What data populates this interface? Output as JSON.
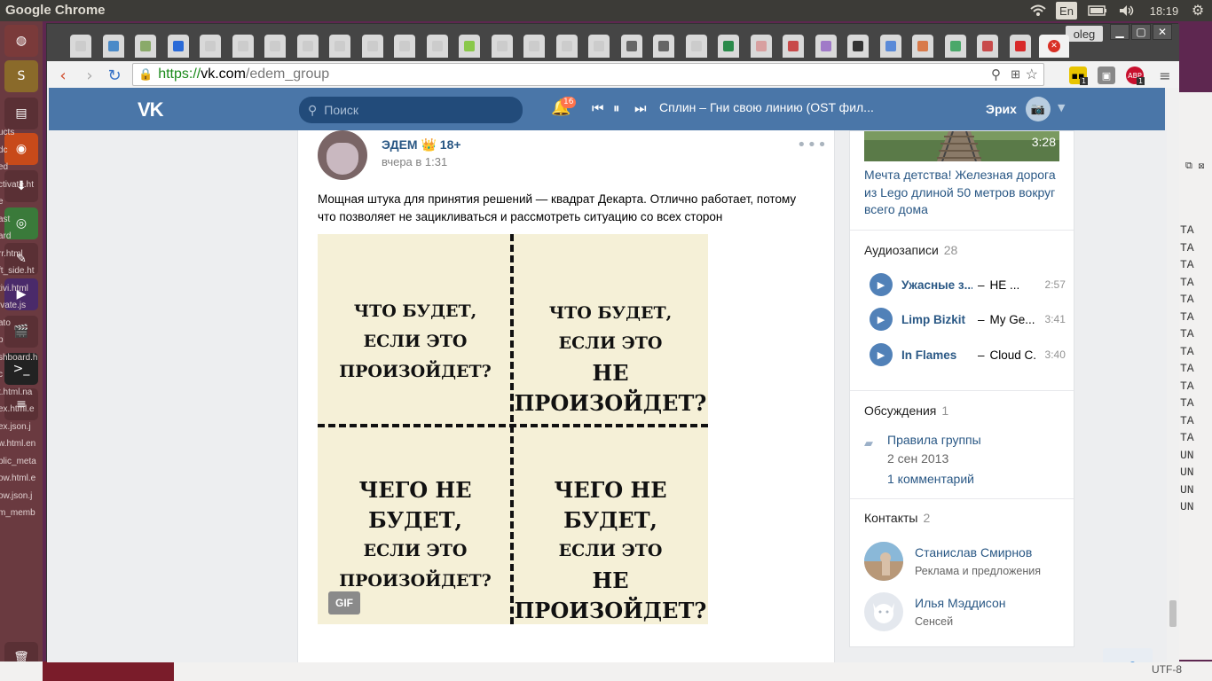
{
  "os": {
    "app_title": "Google Chrome",
    "lang": "En",
    "time": "18:19",
    "user": "oleg"
  },
  "browser": {
    "url_proto": "https://",
    "url_host": "vk.com",
    "url_path": "/edem_group",
    "ext_badges": [
      "1",
      "1",
      "1"
    ],
    "ext_abp": "ABP"
  },
  "behind_window": {
    "left_fragments": [
      "ucts",
      "dc",
      "ed",
      "ctivate.ht",
      "e",
      "ast",
      "ard",
      "rr.html",
      "ft_side.ht",
      "tivi.html",
      "ivate.js",
      "ato",
      "p",
      "shboard.h",
      "c",
      "t.html.na",
      "",
      "",
      "ex.html.e",
      "ex.json.j",
      "w.html.en",
      "blic_meta",
      "ow.html.e",
      "ow.json.j",
      "m_memb"
    ],
    "right_fragments": [
      "TA",
      "TA",
      "TA",
      "TA",
      "TA",
      "TA",
      "TA",
      "TA",
      "TA",
      "TA",
      "TA",
      "TA",
      "TA",
      "UN",
      "UN",
      "UN",
      "UN"
    ],
    "encoding": "UTF-8"
  },
  "vk": {
    "logo": "VK",
    "search_placeholder": "Поиск",
    "notifications": "16",
    "now_playing": "Сплин – Гни свою линию (OST фил...",
    "user_name": "Эрих"
  },
  "post": {
    "author": "ЭДЕМ 👑 18+",
    "time": "вчера в 1:31",
    "text": "Мощная штука для принятия решений — квадрат Декарта. Отлично работает, потому что позволяет не зацикливаться и рассмотреть ситуацию со всех сторон",
    "image_q1": [
      "ЧТО БУДЕТ,",
      "ЕСЛИ ЭТО",
      "ПРОИЗОЙДЕТ?"
    ],
    "image_q2": [
      "ЧТО БУДЕТ,",
      "ЕСЛИ ЭТО",
      "НЕ ПРОИЗОЙДЕТ?"
    ],
    "image_q3": [
      "ЧЕГО НЕ БУДЕТ,",
      "ЕСЛИ ЭТО",
      "ПРОИЗОЙДЕТ?"
    ],
    "image_q4": [
      "ЧЕГО НЕ БУДЕТ,",
      "ЕСЛИ ЭТО",
      "НЕ ПРОИЗОЙДЕТ?"
    ],
    "gif_label": "GIF"
  },
  "sidebar": {
    "video_duration": "3:28",
    "video_title": "Мечта детства! Железная дорога из Lego длиной 50 метров вокруг всего дома",
    "audio_header": "Аудиозаписи",
    "audio_count": "28",
    "audio": [
      {
        "artist": "Ужасные з...",
        "song": "НЕ ...",
        "duration": "2:57"
      },
      {
        "artist": "Limp Bizkit",
        "song": "My Ge...",
        "duration": "3:41"
      },
      {
        "artist": "In Flames",
        "song": "Cloud C...",
        "duration": "3:40"
      }
    ],
    "discussions_header": "Обсуждения",
    "discussions_count": "1",
    "discussion_title": "Правила группы",
    "discussion_date": "2 сен 2013",
    "discussion_comments": "1 комментарий",
    "contacts_header": "Контакты",
    "contacts_count": "2",
    "contacts": [
      {
        "name": "Станислав Смирнов",
        "role": "Реклама и предложения"
      },
      {
        "name": "Илья Мэддисон",
        "role": "Сенсей"
      }
    ],
    "fab_count": "1"
  }
}
